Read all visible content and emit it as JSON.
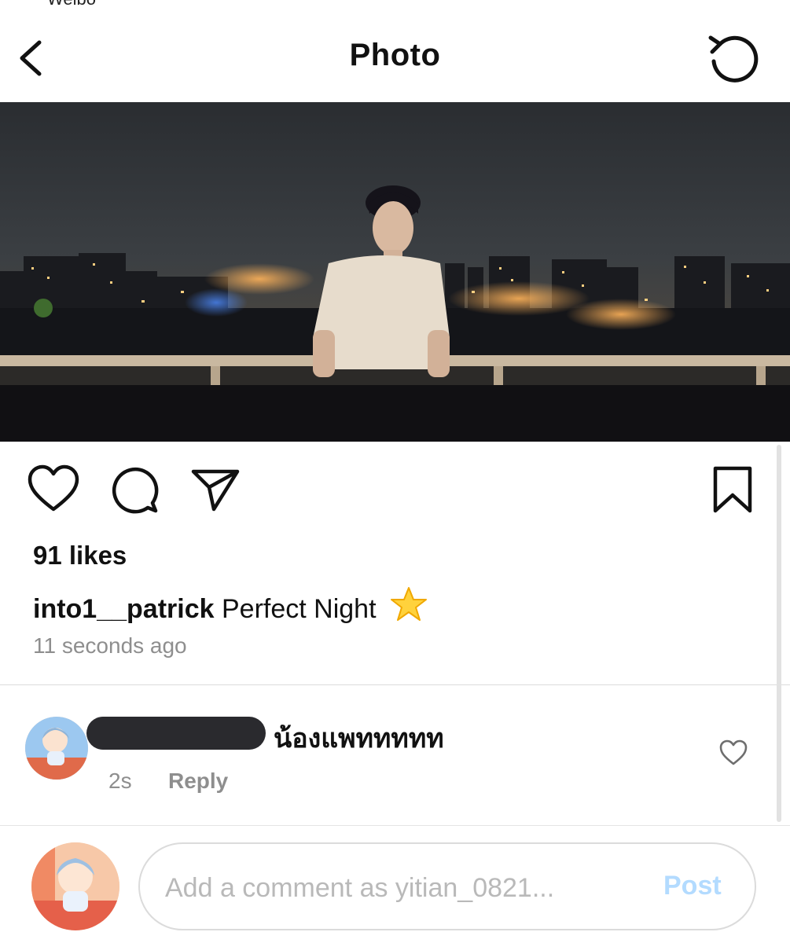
{
  "status_fragment": "Weibo",
  "header": {
    "back_icon": "chevron-left-icon",
    "title": "Photo",
    "refresh_icon": "refresh-icon"
  },
  "photo": {
    "subject": "man in white t-shirt on balcony with night city skyline"
  },
  "actions": {
    "like_icon": "heart-icon",
    "comment_icon": "comment-bubble-icon",
    "share_icon": "paper-plane-icon",
    "save_icon": "bookmark-icon"
  },
  "post": {
    "likes": "91 likes",
    "username": "into1__patrick",
    "caption": "Perfect Night",
    "emoji": "star-emoji",
    "time": "11 seconds ago"
  },
  "comment": {
    "text": "น้องแพททททท",
    "time": "2s",
    "reply_label": "Reply"
  },
  "composer": {
    "placeholder": "Add a comment as yitian_0821...",
    "post_label": "Post"
  },
  "colors": {
    "accent_disabled": "#b3dbff",
    "secondary_text": "#8e8e8e",
    "divider": "#dbdbdb"
  }
}
